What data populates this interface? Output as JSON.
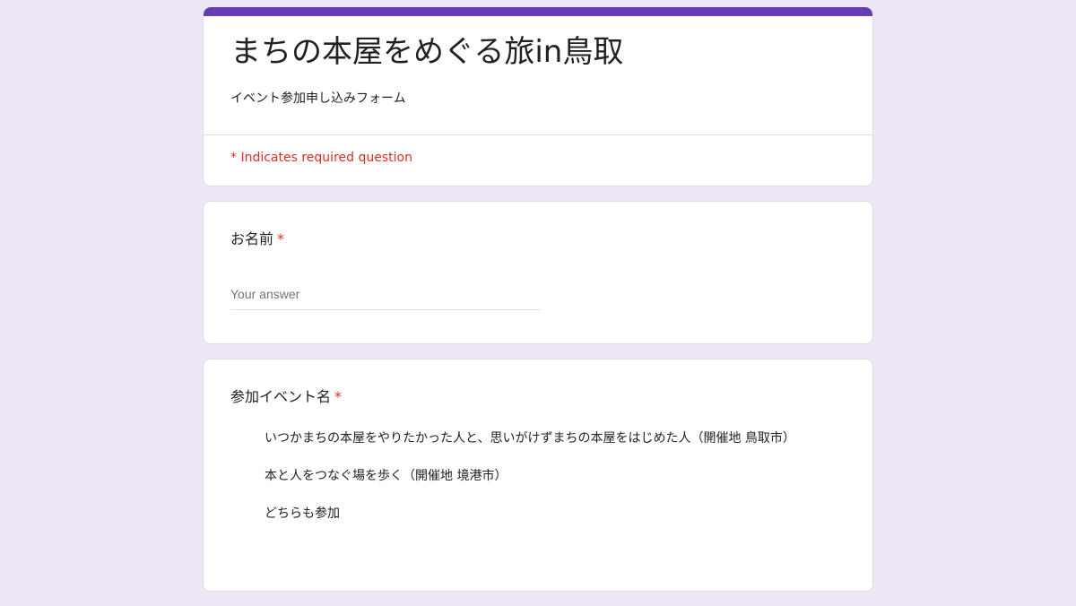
{
  "form": {
    "title": "まちの本屋をめぐる旅in鳥取",
    "description": "イベント参加申し込みフォーム",
    "required_note": "* Indicates required question",
    "accent_color": "#673ab7",
    "background_color": "#ede7f6",
    "required_color": "#d93025"
  },
  "questions": {
    "name": {
      "label": "お名前",
      "required_mark": "*",
      "placeholder": "Your answer"
    },
    "event": {
      "label": "参加イベント名",
      "required_mark": "*",
      "options": [
        "いつかまちの本屋をやりたかった人と、思いがけずまちの本屋をはじめた人（開催地 鳥取市）",
        "本と人をつなぐ場を歩く（開催地 境港市）",
        "どちらも参加"
      ]
    }
  }
}
